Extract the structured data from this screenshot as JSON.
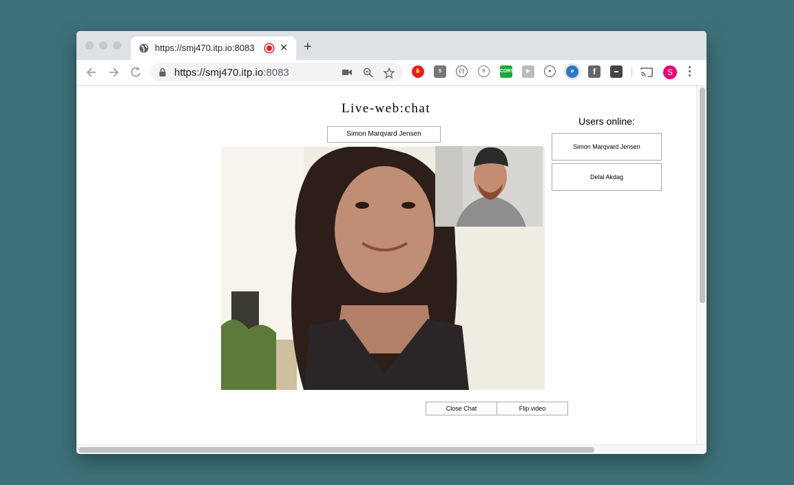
{
  "browser": {
    "tab": {
      "title": "https://smj470.itp.io:8083"
    },
    "address": {
      "host": "https://smj470.itp.io",
      "port": ":8083"
    },
    "extensions": [
      "stop-hand-icon",
      "s-extension-icon",
      "brackets-icon",
      "skype-icon",
      "cors-icon",
      "video-ext-icon",
      "drop-icon",
      "compass-icon",
      "facebook-icon",
      "jira-icon",
      "cast-icon"
    ],
    "cors_label": "CORS",
    "avatar_letter": "S"
  },
  "page": {
    "title": "Live-web:chat",
    "username": "Simon Marqvard Jensen",
    "users_title": "Users online:",
    "users": [
      "Simon Marqvard Jensen",
      "Delal Akdag"
    ],
    "buttons": {
      "close_chat": "Close Chat",
      "flip_video": "Flip video"
    }
  }
}
